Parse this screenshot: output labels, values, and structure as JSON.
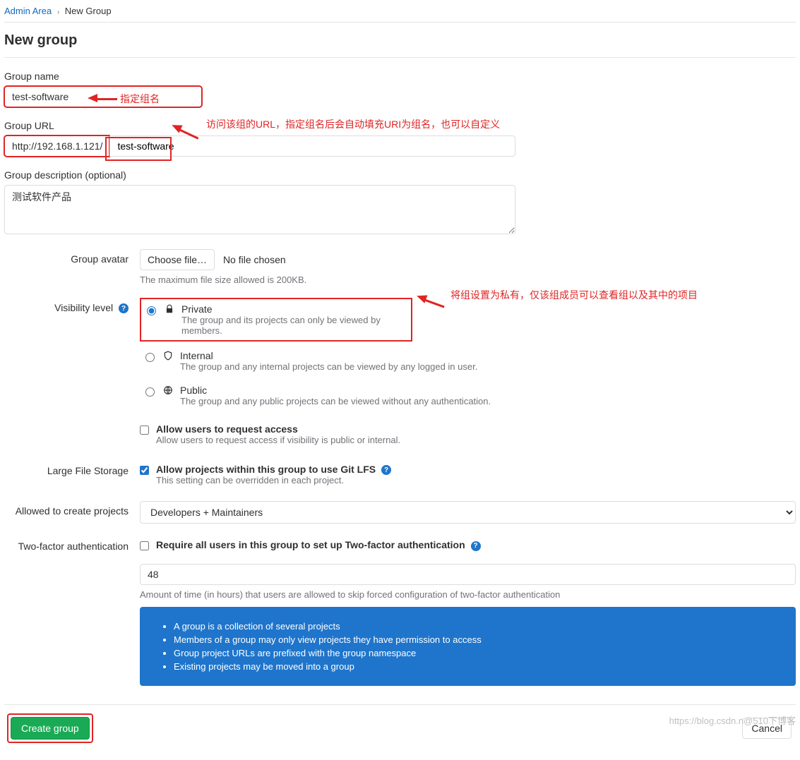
{
  "breadcrumb": {
    "root": "Admin Area",
    "current": "New Group"
  },
  "page_title": "New group",
  "name": {
    "label": "Group name",
    "value": "test-software",
    "annotation": "指定组名"
  },
  "url": {
    "label": "Group URL",
    "prefix": "http://192.168.1.121/",
    "value": "test-software",
    "annotation": "访问该组的URL，指定组名后会自动填充URI为组名，也可以自定义"
  },
  "description": {
    "label": "Group description (optional)",
    "value": "测试软件产品"
  },
  "avatar": {
    "label": "Group avatar",
    "button": "Choose file…",
    "status": "No file chosen",
    "help": "The maximum file size allowed is 200KB."
  },
  "visibility": {
    "label": "Visibility level",
    "annotation": "将组设置为私有，仅该组成员可以查看组以及其中的项目",
    "options": [
      {
        "title": "Private",
        "desc": "The group and its projects can only be viewed by members.",
        "selected": true,
        "icon": "lock-icon"
      },
      {
        "title": "Internal",
        "desc": "The group and any internal projects can be viewed by any logged in user.",
        "selected": false,
        "icon": "shield-icon"
      },
      {
        "title": "Public",
        "desc": "The group and any public projects can be viewed without any authentication.",
        "selected": false,
        "icon": "globe-icon"
      }
    ]
  },
  "request_access": {
    "title": "Allow users to request access",
    "desc": "Allow users to request access if visibility is public or internal.",
    "checked": false
  },
  "lfs": {
    "label": "Large File Storage",
    "title": "Allow projects within this group to use Git LFS",
    "desc": "This setting can be overridden in each project.",
    "checked": true
  },
  "allowed_create": {
    "label": "Allowed to create projects",
    "selected": "Developers + Maintainers"
  },
  "two_factor": {
    "label": "Two-factor authentication",
    "title": "Require all users in this group to set up Two-factor authentication",
    "checked": false,
    "hours_value": "48",
    "hours_desc": "Amount of time (in hours) that users are allowed to skip forced configuration of two-factor authentication"
  },
  "info_list": [
    "A group is a collection of several projects",
    "Members of a group may only view projects they have permission to access",
    "Group project URLs are prefixed with the group namespace",
    "Existing projects may be moved into a group"
  ],
  "buttons": {
    "submit": "Create group",
    "cancel": "Cancel"
  },
  "watermark": "https://blog.csdn.n@510下博客"
}
